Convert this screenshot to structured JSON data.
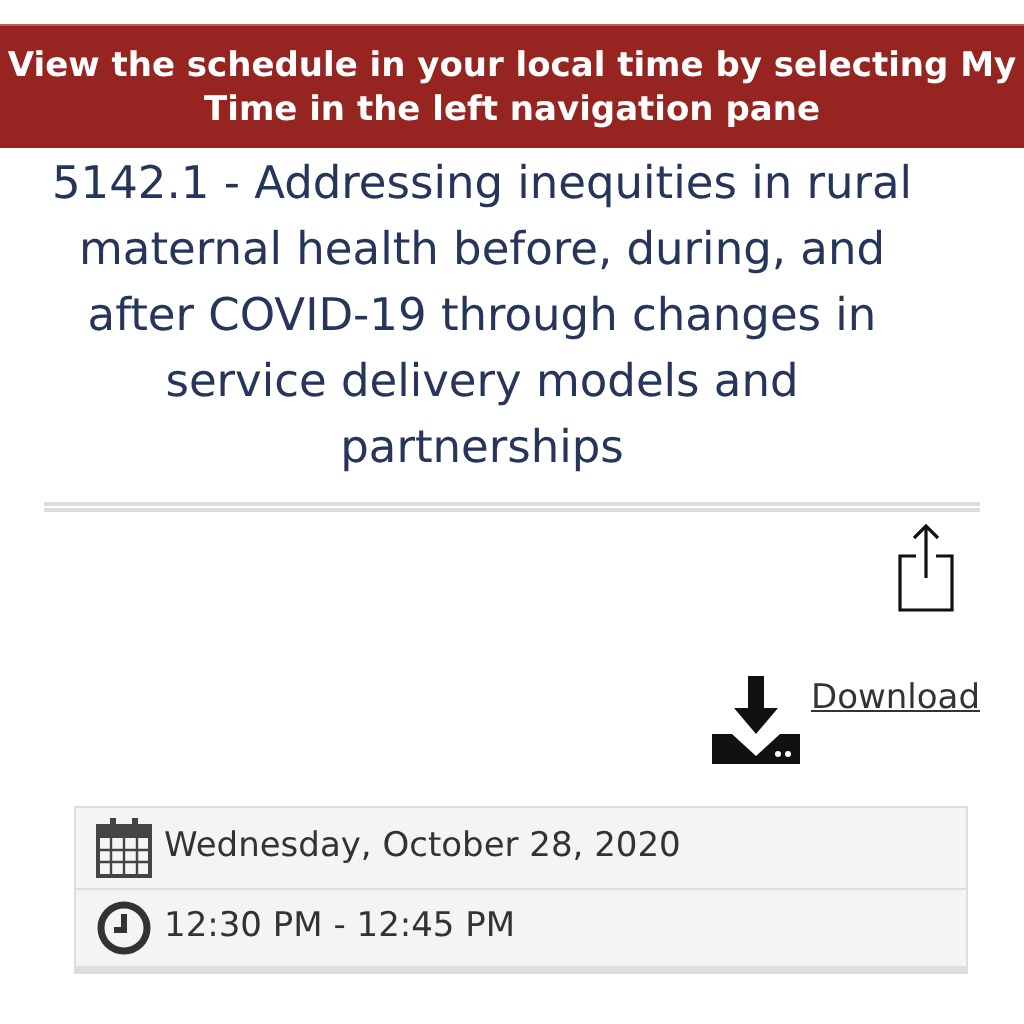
{
  "banner": {
    "text": "View the schedule in your local time by selecting My Time in the left navigation pane"
  },
  "session": {
    "title": "5142.1 - Addressing inequities in rural maternal health before, during, and after COVID-19 through changes in service delivery models and partnerships"
  },
  "download": {
    "label": "Download"
  },
  "details": [
    {
      "kind": "date",
      "text": "Wednesday, October 28, 2020"
    },
    {
      "kind": "time",
      "text": "12:30 PM - 12:45 PM"
    }
  ]
}
